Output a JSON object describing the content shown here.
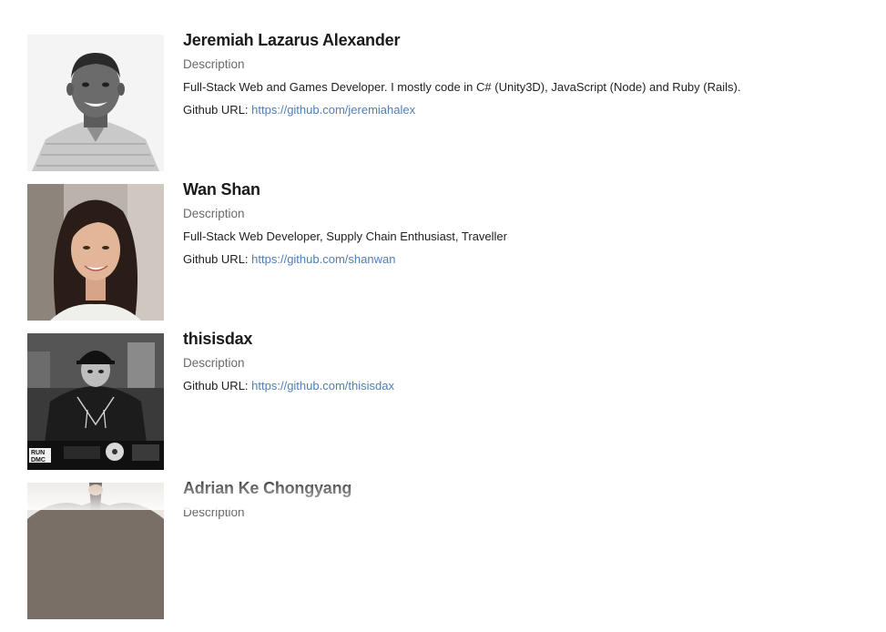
{
  "members": [
    {
      "name": "Jeremiah Lazarus Alexander",
      "description_label": "Description",
      "description": "Full-Stack Web and Games Developer. I mostly code in C# (Unity3D), JavaScript (Node) and Ruby (Rails).",
      "github_label": "Github URL:",
      "github_url": "https://github.com/jeremiahalex"
    },
    {
      "name": "Wan Shan",
      "description_label": "Description",
      "description": "Full-Stack Web Developer, Supply Chain Enthusiast, Traveller",
      "github_label": "Github URL:",
      "github_url": "https://github.com/shanwan"
    },
    {
      "name": "thisisdax",
      "description_label": "Description",
      "description": "",
      "github_label": "Github URL:",
      "github_url": "https://github.com/thisisdax"
    },
    {
      "name": "Adrian Ke Chongyang",
      "description_label": "Description",
      "description": "",
      "github_label": "",
      "github_url": ""
    }
  ],
  "photo_shirt_text": [
    "RUN",
    "DMC"
  ],
  "colors": {
    "link": "#4f7fb4",
    "label": "#6a6a6a"
  }
}
